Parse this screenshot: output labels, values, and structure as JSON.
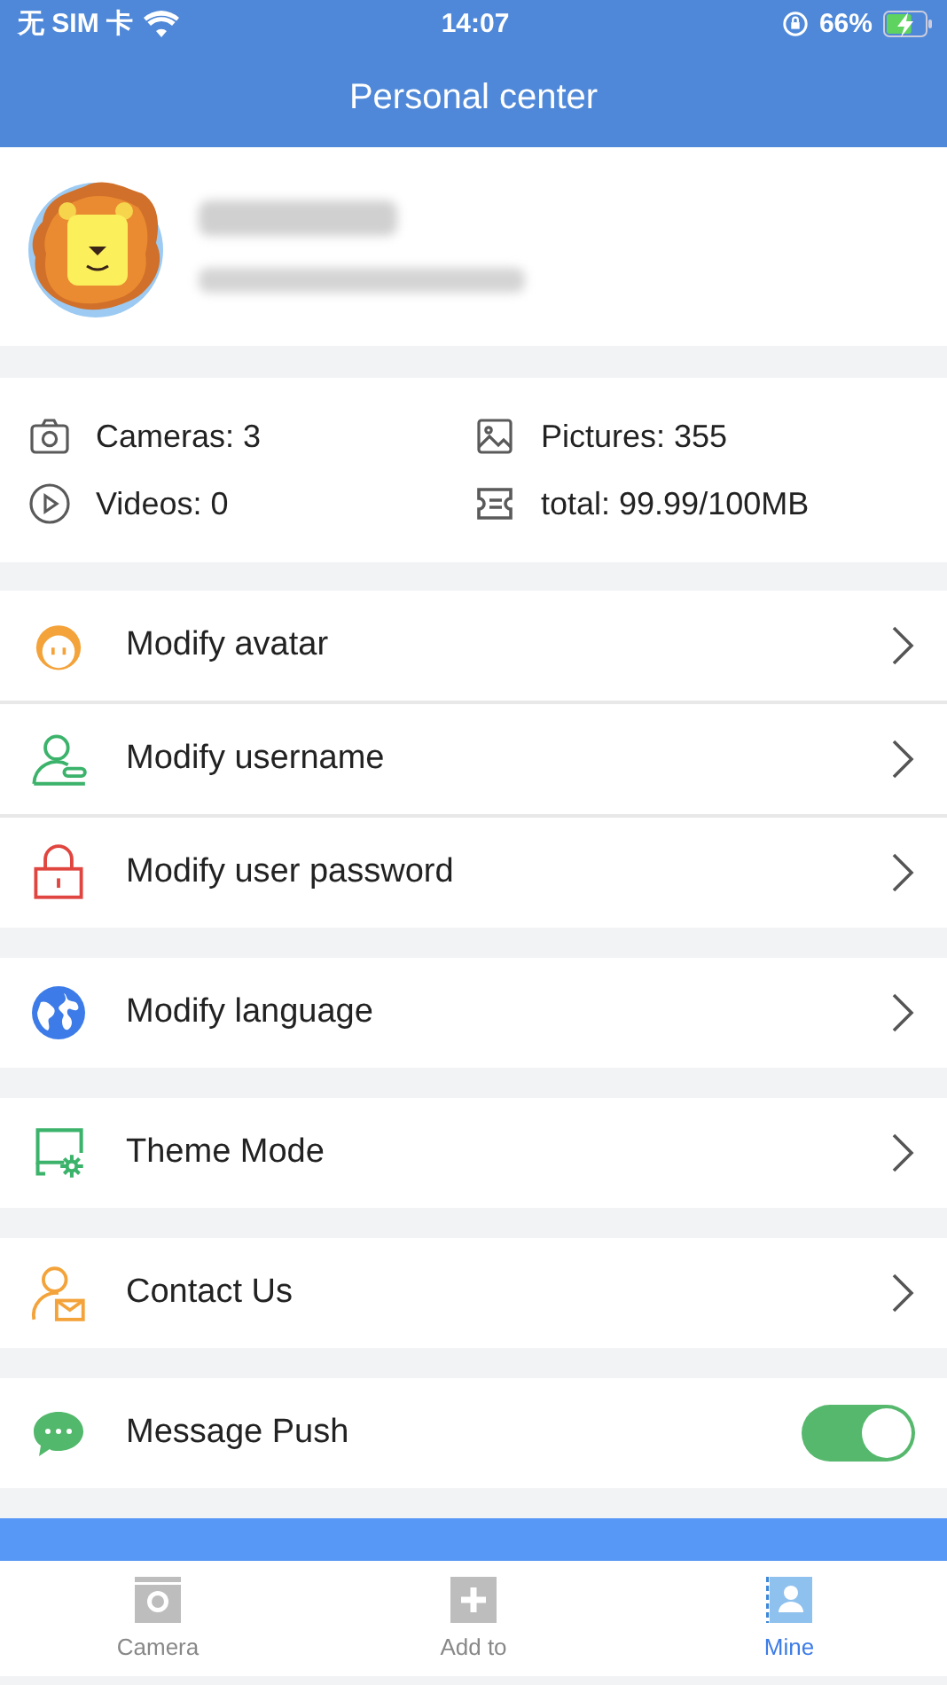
{
  "status_bar": {
    "carrier": "无 SIM 卡",
    "time": "14:07",
    "battery": "66%"
  },
  "header": {
    "title": "Personal center"
  },
  "stats": [
    {
      "label": "Cameras: 3"
    },
    {
      "label": "Pictures: 355"
    },
    {
      "label": "Videos: 0"
    },
    {
      "label": "total: 99.99/100MB"
    }
  ],
  "sections": [
    {
      "items": [
        {
          "kind": "link",
          "label": "Modify avatar"
        },
        {
          "kind": "link",
          "label": "Modify username"
        },
        {
          "kind": "link",
          "label": "Modify user password"
        }
      ]
    },
    {
      "items": [
        {
          "kind": "link",
          "label": "Modify language"
        }
      ]
    },
    {
      "items": [
        {
          "kind": "link",
          "label": "Theme Mode"
        }
      ]
    },
    {
      "items": [
        {
          "kind": "link",
          "label": "Contact Us"
        }
      ]
    },
    {
      "items": [
        {
          "kind": "toggle",
          "label": "Message Push",
          "on": true
        }
      ]
    }
  ],
  "tabs": [
    {
      "label": "Camera",
      "selected": false
    },
    {
      "label": "Add to",
      "selected": false
    },
    {
      "label": "Mine",
      "selected": true
    }
  ]
}
